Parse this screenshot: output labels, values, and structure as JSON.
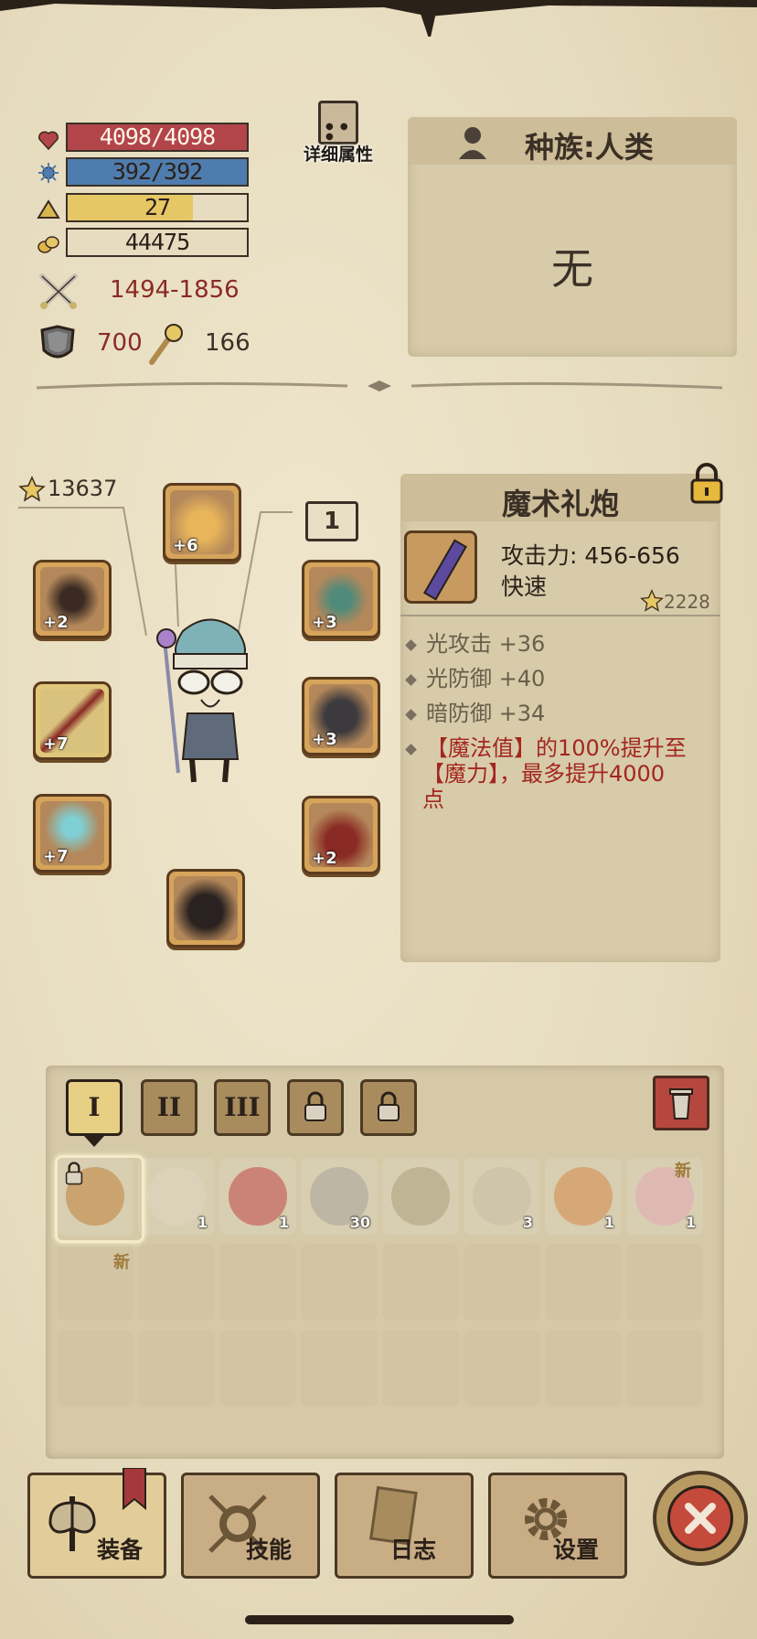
{
  "stats": {
    "hp": {
      "text": "4098/4098",
      "fill": 1.0,
      "color": "#b2454a"
    },
    "mp": {
      "text": "392/392",
      "fill": 1.0,
      "color": "#4f7cae"
    },
    "level": {
      "text": "27",
      "fill": 0.7,
      "color": "#e6c766"
    },
    "gold": {
      "text": "44475"
    },
    "attack": "1494-1856",
    "defense": "700",
    "magic": "166"
  },
  "detail_button": {
    "label": "详细属性"
  },
  "race_panel": {
    "title": "种族:人类",
    "value": "无"
  },
  "hero": {
    "power": "13637",
    "level_badge": "1"
  },
  "slots": {
    "helmet": "+6",
    "gloves": "+2",
    "weapon": "+7",
    "ring": "+7",
    "amulet": "+3",
    "armor": "+3",
    "cape": "+2"
  },
  "item_detail": {
    "name": "魔术礼炮",
    "attack_line": "攻击力: 456-656",
    "speed": "快速",
    "score": "2228",
    "effects": [
      "光攻击 +36",
      "光防御 +40",
      "暗防御 +34"
    ],
    "special_line1": "【魔法值】的100%提升至",
    "special_line2": "【魔力】，最多提升4000",
    "special_line3": "点"
  },
  "bag_tabs": [
    "I",
    "II",
    "III"
  ],
  "inventory": [
    {
      "name": "magic-cannon",
      "count": ""
    },
    {
      "name": "scroll",
      "count": "1"
    },
    {
      "name": "red-potion",
      "count": "1"
    },
    {
      "name": "stone-blocks",
      "count": "30"
    },
    {
      "name": "mushrooms",
      "count": ""
    },
    {
      "name": "feathers",
      "count": "3"
    },
    {
      "name": "fire-potion",
      "count": "1"
    },
    {
      "name": "pink-potion",
      "count": "1"
    }
  ],
  "new_badge": "新",
  "nav": {
    "equip": "装备",
    "skills": "技能",
    "log": "日志",
    "settings": "设置"
  },
  "colors": {
    "red_text": "#a3261f",
    "accent": "#c9ad85"
  }
}
